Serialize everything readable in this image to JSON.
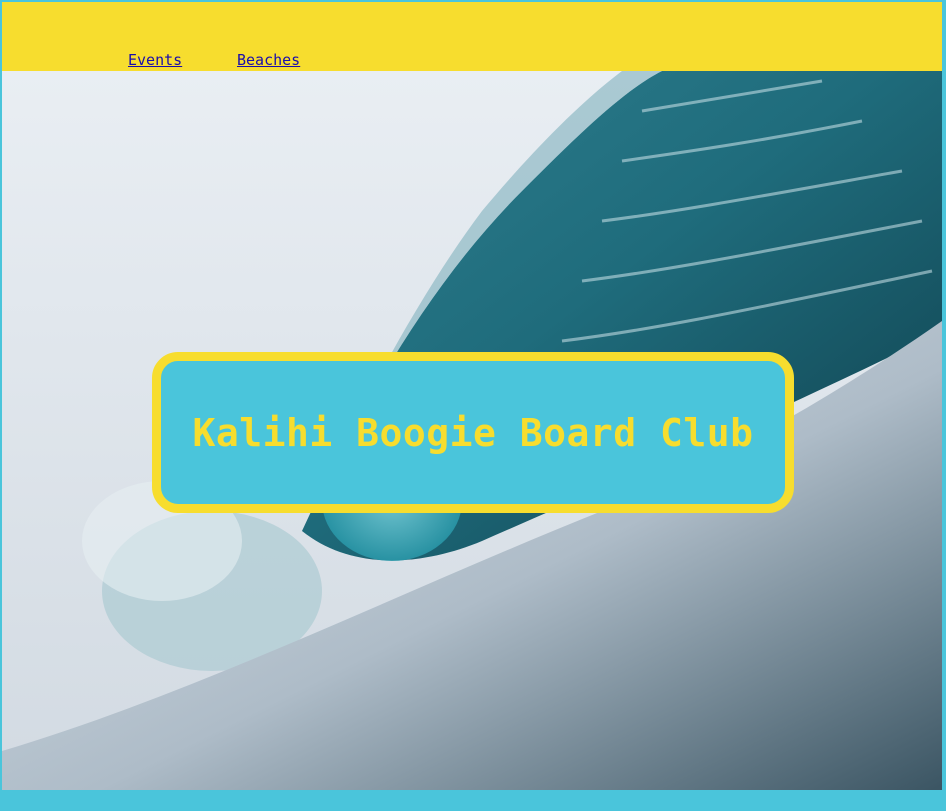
{
  "nav": {
    "links": [
      {
        "label": "Events"
      },
      {
        "label": "Beaches"
      }
    ]
  },
  "hero": {
    "image": "ocean-wave-photo",
    "title": "Kalihi Boogie Board Club"
  },
  "colors": {
    "accent_yellow": "#f7dd2e",
    "accent_teal": "#4ac5db",
    "link": "#1a0dab"
  }
}
